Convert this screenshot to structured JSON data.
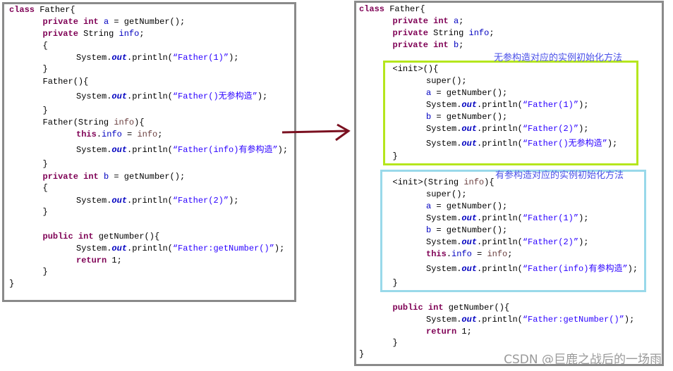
{
  "left_code": [
    [
      [
        "class",
        "kw"
      ],
      [
        " Father{",
        ""
      ]
    ],
    [
      [
        "private",
        "kw"
      ],
      [
        " ",
        ""
      ],
      [
        "int",
        "kw"
      ],
      [
        " ",
        ""
      ],
      [
        "a",
        "fld"
      ],
      [
        " = getNumber();",
        ""
      ]
    ],
    [
      [
        "private",
        "kw"
      ],
      [
        " String ",
        ""
      ],
      [
        "info",
        "fld"
      ],
      [
        ";",
        ""
      ]
    ],
    [
      [
        "{",
        ""
      ]
    ],
    [
      [
        "System.",
        ""
      ],
      [
        "out",
        "out"
      ],
      [
        ".println(",
        ""
      ],
      [
        "“Father(1)”",
        "str"
      ],
      [
        ");",
        ""
      ]
    ],
    [
      [
        "}",
        ""
      ]
    ],
    [
      [
        "Father(){",
        ""
      ]
    ],
    [
      [
        "System.",
        ""
      ],
      [
        "out",
        "out"
      ],
      [
        ".println(",
        ""
      ],
      [
        "“Father()无参构造”",
        "str"
      ],
      [
        ");",
        ""
      ]
    ],
    [
      [
        "}",
        ""
      ]
    ],
    [
      [
        "Father(String ",
        ""
      ],
      [
        "info",
        "param"
      ],
      [
        "){",
        ""
      ]
    ],
    [
      [
        "this",
        "kw"
      ],
      [
        ".",
        ""
      ],
      [
        "info",
        "fld"
      ],
      [
        " = ",
        ""
      ],
      [
        "info",
        "param"
      ],
      [
        ";",
        ""
      ]
    ],
    [
      [
        "System.",
        ""
      ],
      [
        "out",
        "out"
      ],
      [
        ".println(",
        ""
      ],
      [
        "“Father(info)有参构造”",
        "str"
      ],
      [
        ");",
        ""
      ]
    ],
    [
      [
        "}",
        ""
      ]
    ],
    [
      [
        "private",
        "kw"
      ],
      [
        " ",
        ""
      ],
      [
        "int",
        "kw"
      ],
      [
        " ",
        ""
      ],
      [
        "b",
        "fld"
      ],
      [
        " = getNumber();",
        ""
      ]
    ],
    [
      [
        "{",
        ""
      ]
    ],
    [
      [
        "System.",
        ""
      ],
      [
        "out",
        "out"
      ],
      [
        ".println(",
        ""
      ],
      [
        "“Father(2)”",
        "str"
      ],
      [
        ");",
        ""
      ]
    ],
    [
      [
        "}",
        ""
      ]
    ],
    [
      [
        "public",
        "kw"
      ],
      [
        " ",
        ""
      ],
      [
        "int",
        "kw"
      ],
      [
        " getNumber(){",
        ""
      ]
    ],
    [
      [
        "System.",
        ""
      ],
      [
        "out",
        "out"
      ],
      [
        ".println(",
        ""
      ],
      [
        "“Father:getNumber()”",
        "str"
      ],
      [
        ");",
        ""
      ]
    ],
    [
      [
        "return",
        "kw"
      ],
      [
        " 1;",
        ""
      ]
    ],
    [
      [
        "}",
        ""
      ]
    ],
    [
      [
        "}",
        ""
      ]
    ]
  ],
  "right_code": [
    [
      [
        "class",
        "kw"
      ],
      [
        " Father{",
        ""
      ]
    ],
    [
      [
        "private",
        "kw"
      ],
      [
        " ",
        ""
      ],
      [
        "int",
        "kw"
      ],
      [
        " ",
        ""
      ],
      [
        "a",
        "fld"
      ],
      [
        ";",
        ""
      ]
    ],
    [
      [
        "private",
        "kw"
      ],
      [
        " String ",
        ""
      ],
      [
        "info",
        "fld"
      ],
      [
        ";",
        ""
      ]
    ],
    [
      [
        "private",
        "kw"
      ],
      [
        " ",
        ""
      ],
      [
        "int",
        "kw"
      ],
      [
        " ",
        ""
      ],
      [
        "b",
        "fld"
      ],
      [
        ";",
        ""
      ]
    ],
    [
      [
        "<init>(){",
        ""
      ]
    ],
    [
      [
        "super();",
        ""
      ]
    ],
    [
      [
        "a",
        "fld"
      ],
      [
        " = getNumber();",
        ""
      ]
    ],
    [
      [
        "System.",
        ""
      ],
      [
        "out",
        "out"
      ],
      [
        ".println(",
        ""
      ],
      [
        "“Father(1)”",
        "str"
      ],
      [
        ");",
        ""
      ]
    ],
    [
      [
        "b",
        "fld"
      ],
      [
        " = getNumber();",
        ""
      ]
    ],
    [
      [
        "System.",
        ""
      ],
      [
        "out",
        "out"
      ],
      [
        ".println(",
        ""
      ],
      [
        "“Father(2)”",
        "str"
      ],
      [
        ");",
        ""
      ]
    ],
    [
      [
        "System.",
        ""
      ],
      [
        "out",
        "out"
      ],
      [
        ".println(",
        ""
      ],
      [
        "“Father()无参构造”",
        "str"
      ],
      [
        ");",
        ""
      ]
    ],
    [
      [
        "}",
        ""
      ]
    ],
    [
      [
        "<init>(String ",
        ""
      ],
      [
        "info",
        "param"
      ],
      [
        "){",
        ""
      ]
    ],
    [
      [
        "super();",
        ""
      ]
    ],
    [
      [
        "a",
        "fld"
      ],
      [
        " = getNumber();",
        ""
      ]
    ],
    [
      [
        "System.",
        ""
      ],
      [
        "out",
        "out"
      ],
      [
        ".println(",
        ""
      ],
      [
        "“Father(1)”",
        "str"
      ],
      [
        ");",
        ""
      ]
    ],
    [
      [
        "b",
        "fld"
      ],
      [
        " = getNumber();",
        ""
      ]
    ],
    [
      [
        "System.",
        ""
      ],
      [
        "out",
        "out"
      ],
      [
        ".println(",
        ""
      ],
      [
        "“Father(2)”",
        "str"
      ],
      [
        ");",
        ""
      ]
    ],
    [
      [
        "this",
        "kw"
      ],
      [
        ".",
        ""
      ],
      [
        "info",
        "fld"
      ],
      [
        " = ",
        ""
      ],
      [
        "info",
        "param"
      ],
      [
        ";",
        ""
      ]
    ],
    [
      [
        "System.",
        ""
      ],
      [
        "out",
        "out"
      ],
      [
        ".println(",
        ""
      ],
      [
        "“Father(info)有参构造”",
        "str"
      ],
      [
        ");",
        ""
      ]
    ],
    [
      [
        "}",
        ""
      ]
    ],
    [
      [
        "public",
        "kw"
      ],
      [
        " ",
        ""
      ],
      [
        "int",
        "kw"
      ],
      [
        " getNumber(){",
        ""
      ]
    ],
    [
      [
        "System.",
        ""
      ],
      [
        "out",
        "out"
      ],
      [
        ".println(",
        ""
      ],
      [
        "“Father:getNumber()”",
        "str"
      ],
      [
        ");",
        ""
      ]
    ],
    [
      [
        "return",
        "kw"
      ],
      [
        " 1;",
        ""
      ]
    ],
    [
      [
        "}",
        ""
      ]
    ],
    [
      [
        "}",
        ""
      ]
    ]
  ],
  "annotations": {
    "no_arg_label": "无参构造对应的实例初始化方法",
    "arg_label": "有参构造对应的实例初始化方法"
  },
  "colors": {
    "no_arg_box": "#b5e61d",
    "arg_box": "#99d9ea",
    "arrow": "#7a1020",
    "keyword": "#7f0055",
    "field": "#0000c0",
    "string": "#2a00ff"
  },
  "watermark": "CSDN @巨鹿之战后的一场雨"
}
